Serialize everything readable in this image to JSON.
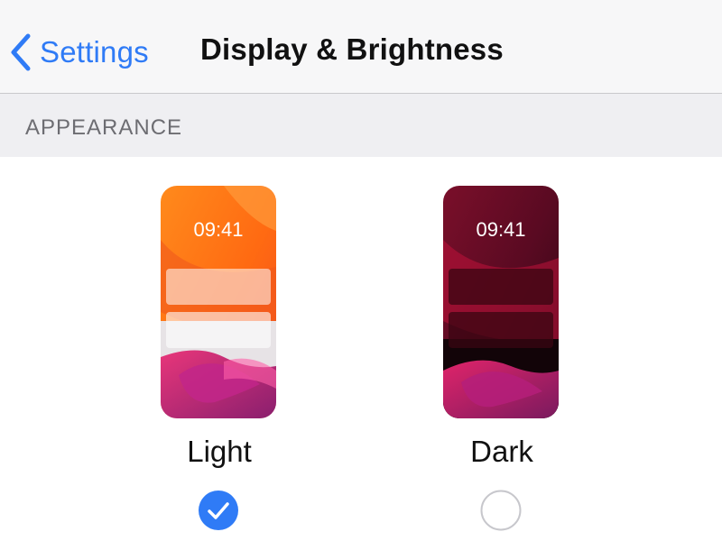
{
  "navbar": {
    "back_label": "Settings",
    "title": "Display & Brightness",
    "back_icon": "chevron-left-icon",
    "accent_color": "#2f7bf6"
  },
  "appearance": {
    "section_label": "APPEARANCE",
    "options": [
      {
        "label": "Light",
        "preview_time": "09:41",
        "selected": true,
        "icon": "checkmark-circle-icon"
      },
      {
        "label": "Dark",
        "preview_time": "09:41",
        "selected": false,
        "icon": "empty-circle-icon"
      }
    ]
  }
}
